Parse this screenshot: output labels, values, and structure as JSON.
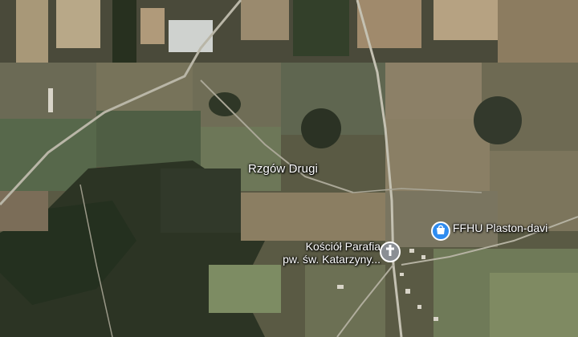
{
  "map": {
    "town": {
      "name": "Rzgów Drugi"
    },
    "pois": [
      {
        "line1": "Kościół Parafia",
        "line2": "pw. św. Katarzyny...",
        "icon": "cross-icon",
        "color": "#8a8e94"
      },
      {
        "line1": "FFHU Plaston-davi",
        "icon": "shopping-bag-icon",
        "color": "#2f8cf0"
      }
    ]
  }
}
